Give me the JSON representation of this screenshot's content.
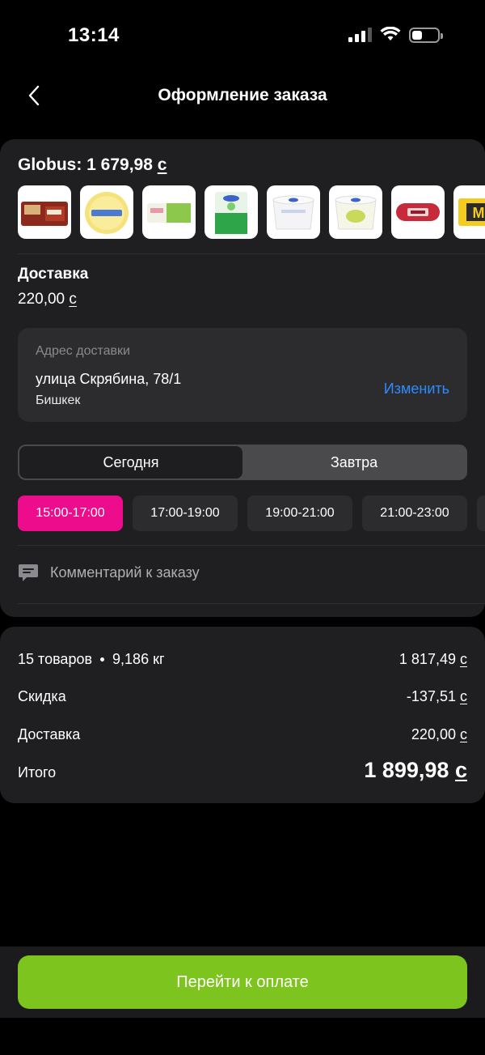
{
  "status_bar": {
    "time": "13:14"
  },
  "header": {
    "title": "Оформление заказа",
    "back_icon": "chevron-left-icon"
  },
  "store": {
    "name_total": "Globus: 1 679,98",
    "currency": "с",
    "products": [
      {
        "name": "product-chocolate-bars",
        "colors": [
          "#8b2a1c",
          "#d9b07a"
        ]
      },
      {
        "name": "product-cheese",
        "colors": [
          "#f5e27a",
          "#4a7bd0"
        ]
      },
      {
        "name": "product-butter",
        "colors": [
          "#f1f1e6",
          "#8cc84b"
        ]
      },
      {
        "name": "product-cottage-cheese-green",
        "colors": [
          "#2fa54a",
          "#e8f4e8"
        ]
      },
      {
        "name": "product-yogurt-cup",
        "colors": [
          "#f4f4f6",
          "#3b63c9"
        ]
      },
      {
        "name": "product-cottage-cheese-cup",
        "colors": [
          "#f6f6e8",
          "#c8d95b"
        ]
      },
      {
        "name": "product-sausage",
        "colors": [
          "#c72a3a",
          "#f2d3d3"
        ]
      },
      {
        "name": "product-cheese-m",
        "colors": [
          "#f4cc1f",
          "#2b2b2b"
        ]
      }
    ]
  },
  "delivery": {
    "label": "Доставка",
    "price": "220,00",
    "address": {
      "caption": "Адрес доставки",
      "street": "улица Скрябина, 78/1",
      "city": "Бишкек",
      "change_label": "Изменить"
    }
  },
  "day_selector": {
    "today": "Сегодня",
    "tomorrow": "Завтра",
    "selected": "today"
  },
  "time_slots": [
    "15:00-17:00",
    "17:00-19:00",
    "19:00-21:00",
    "21:00-23:00"
  ],
  "selected_slot": 0,
  "comment": {
    "label": "Комментарий к заказу",
    "icon": "comment-icon"
  },
  "summary": {
    "items_count": "15 товаров",
    "weight": "9,186 кг",
    "items_total": "1 817,49",
    "discount_label": "Скидка",
    "discount_value": "-137,51",
    "delivery_label": "Доставка",
    "delivery_value": "220,00",
    "total_label": "Итого",
    "total_value": "1 899,98",
    "currency": "с"
  },
  "pay_button": {
    "label": "Перейти к оплате"
  },
  "colors": {
    "accent_pink": "#ec0c8c",
    "accent_green": "#7dc41f",
    "link_blue": "#2e8bff",
    "card_bg": "#1f1f21"
  }
}
